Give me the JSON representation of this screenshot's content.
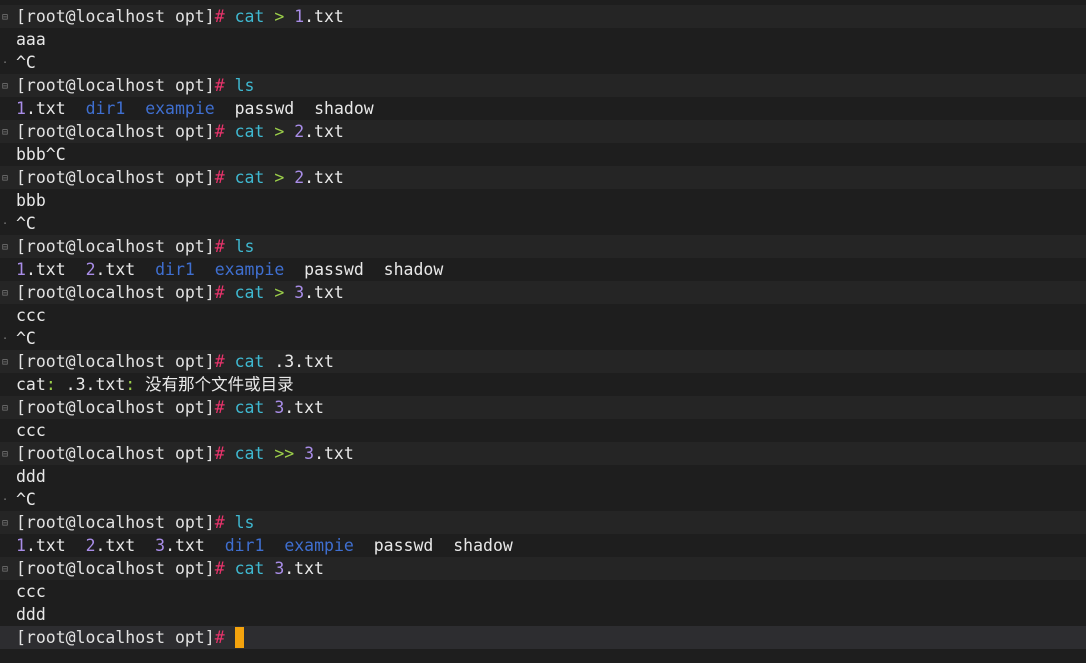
{
  "prompt": "[root@localhost opt]",
  "hash": "#",
  "lines": {
    "l1": {
      "cmd": "cat",
      "op": ">",
      "num": "1",
      "rest": ".txt"
    },
    "l2": {
      "text": "aaa"
    },
    "l3": {
      "text": "^C"
    },
    "l4": {
      "cmd": "ls"
    },
    "l5": {
      "f1n": "1",
      "f1r": ".txt",
      "d1": "dir1",
      "d2": "exampie",
      "f2": "passwd",
      "f3": "shadow"
    },
    "l6": {
      "cmd": "cat",
      "op": ">",
      "num": "2",
      "rest": ".txt"
    },
    "l7": {
      "text": "bbb^C"
    },
    "l8": {
      "cmd": "cat",
      "op": ">",
      "num": "2",
      "rest": ".txt"
    },
    "l9": {
      "text": "bbb"
    },
    "l10": {
      "text": "^C"
    },
    "l11": {
      "cmd": "ls"
    },
    "l12": {
      "f1n": "1",
      "f1r": ".txt",
      "f2n": "2",
      "f2r": ".txt",
      "d1": "dir1",
      "d2": "exampie",
      "f3": "passwd",
      "f4": "shadow"
    },
    "l13": {
      "cmd": "cat",
      "op": ">",
      "num": "3",
      "rest": ".txt"
    },
    "l14": {
      "text": "ccc"
    },
    "l15": {
      "text": "^C"
    },
    "l16": {
      "cmd": "cat",
      "arg": ".3.txt"
    },
    "l17": {
      "a": "cat",
      "c1": ":",
      "b": " .3.txt",
      "c2": ":",
      "msg": " 没有那个文件或目录"
    },
    "l18": {
      "cmd": "cat",
      "num": "3",
      "rest": ".txt"
    },
    "l19": {
      "text": "ccc"
    },
    "l20": {
      "cmd": "cat",
      "op": ">>",
      "num": "3",
      "rest": ".txt"
    },
    "l21": {
      "text": "ddd"
    },
    "l22": {
      "text": "^C"
    },
    "l23": {
      "cmd": "ls"
    },
    "l24": {
      "f1n": "1",
      "f1r": ".txt",
      "f2n": "2",
      "f2r": ".txt",
      "f3n": "3",
      "f3r": ".txt",
      "d1": "dir1",
      "d2": "exampie",
      "f4": "passwd",
      "f5": "shadow"
    },
    "l25": {
      "cmd": "cat",
      "num": "3",
      "rest": ".txt"
    },
    "l26": {
      "text": "ccc"
    },
    "l27": {
      "text": "ddd"
    }
  },
  "colors": {
    "background": "#1e1e1e",
    "hash": "#e8336b",
    "command": "#3fb8d0",
    "operator": "#9cd04a",
    "number": "#a98de8",
    "directory": "#3f6fd0",
    "cursor": "#f4a30d"
  }
}
